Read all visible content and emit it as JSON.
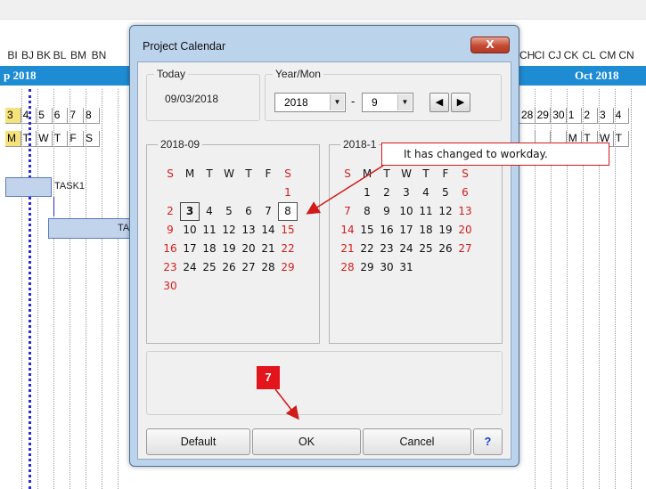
{
  "background": {
    "column_headers": [
      "BI",
      "BJ",
      "BK",
      "BL",
      "BM",
      "BN"
    ],
    "column_headers_right": [
      "CH",
      "CI",
      "CJ",
      "CK",
      "CL",
      "CM",
      "CN"
    ],
    "month_left": "p 2018",
    "month_right": "Oct 2018",
    "days_left": [
      "3",
      "4",
      "5",
      "6",
      "7",
      "8"
    ],
    "dows_left": [
      "M",
      "T",
      "W",
      "T",
      "F",
      "S"
    ],
    "days_right": [
      "28",
      "29",
      "30",
      "1",
      "2",
      "3",
      "4"
    ],
    "dows_right": [
      "",
      "",
      "",
      "M",
      "T",
      "W",
      "T"
    ],
    "tasks": [
      "TASK1",
      "TA"
    ]
  },
  "dialog": {
    "title": "Project Calendar",
    "close_label": "X",
    "today": {
      "label": "Today",
      "value": "09/03/2018"
    },
    "year_mon": {
      "label": "Year/Mon",
      "year": "2018",
      "month": "9",
      "separator": "-",
      "prev_label": "◀",
      "next_label": "▶"
    },
    "calendars": [
      {
        "title": "2018-09",
        "weekdays": [
          "S",
          "M",
          "T",
          "W",
          "T",
          "F",
          "S"
        ],
        "weeks": [
          [
            "",
            "",
            "",
            "",
            "",
            "",
            "1"
          ],
          [
            "2",
            "3",
            "4",
            "5",
            "6",
            "7",
            "8"
          ],
          [
            "9",
            "10",
            "11",
            "12",
            "13",
            "14",
            "15"
          ],
          [
            "16",
            "17",
            "18",
            "19",
            "20",
            "21",
            "22"
          ],
          [
            "23",
            "24",
            "25",
            "26",
            "27",
            "28",
            "29"
          ],
          [
            "30",
            "",
            "",
            "",
            "",
            "",
            ""
          ]
        ]
      },
      {
        "title": "2018-1",
        "weekdays": [
          "S",
          "M",
          "T",
          "W",
          "T",
          "F",
          "S"
        ],
        "weeks": [
          [
            "",
            "1",
            "2",
            "3",
            "4",
            "5",
            "6"
          ],
          [
            "7",
            "8",
            "9",
            "10",
            "11",
            "12",
            "13"
          ],
          [
            "14",
            "15",
            "16",
            "17",
            "18",
            "19",
            "20"
          ],
          [
            "21",
            "22",
            "23",
            "24",
            "25",
            "26",
            "27"
          ],
          [
            "28",
            "29",
            "30",
            "31",
            "",
            "",
            ""
          ]
        ]
      }
    ],
    "buttons": {
      "default": "Default",
      "ok": "OK",
      "cancel": "Cancel",
      "help": "?"
    }
  },
  "annotations": {
    "callout": "It has changed to workday.",
    "step": "7"
  },
  "colors": {
    "holiday": "#d21e1e",
    "accent": "#1e8cd2",
    "annotation": "#e3141b"
  }
}
